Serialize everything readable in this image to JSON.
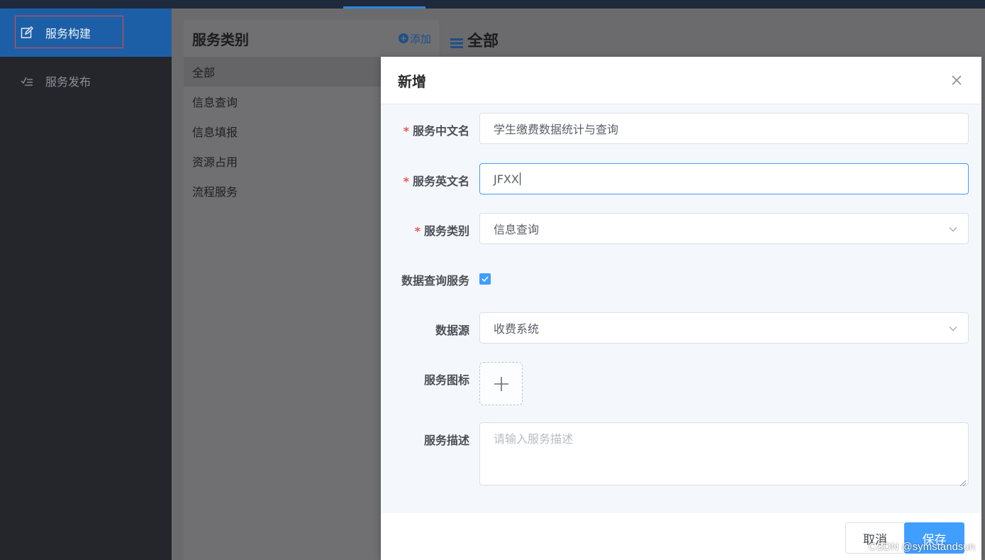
{
  "sidebar": {
    "items": [
      {
        "label": "服务构建",
        "icon": "edit-icon",
        "active": true
      },
      {
        "label": "服务发布",
        "icon": "checklist-icon",
        "active": false
      }
    ]
  },
  "category_panel": {
    "title": "服务类别",
    "add_label": "添加",
    "items": [
      "全部",
      "信息查询",
      "信息填报",
      "资源占用",
      "流程服务"
    ]
  },
  "main": {
    "title": "全部"
  },
  "dialog": {
    "title": "新增",
    "fields": {
      "cn_name": {
        "label": "服务中文名",
        "value": "学生缴费数据统计与查询",
        "required": true
      },
      "en_name": {
        "label": "服务英文名",
        "value": "JFXX",
        "required": true
      },
      "category": {
        "label": "服务类别",
        "value": "信息查询",
        "required": true
      },
      "data_query": {
        "label": "数据查询服务",
        "checked": true
      },
      "datasource": {
        "label": "数据源",
        "value": "收费系统"
      },
      "icon": {
        "label": "服务图标"
      },
      "description": {
        "label": "服务描述",
        "placeholder": "请输入服务描述"
      }
    },
    "cancel_label": "取消",
    "save_label": "保存"
  },
  "watermark": "CSDN @symstandsun",
  "colors": {
    "primary": "#409eff",
    "sidebar_active": "#1d5fa6",
    "required": "#f05454"
  }
}
